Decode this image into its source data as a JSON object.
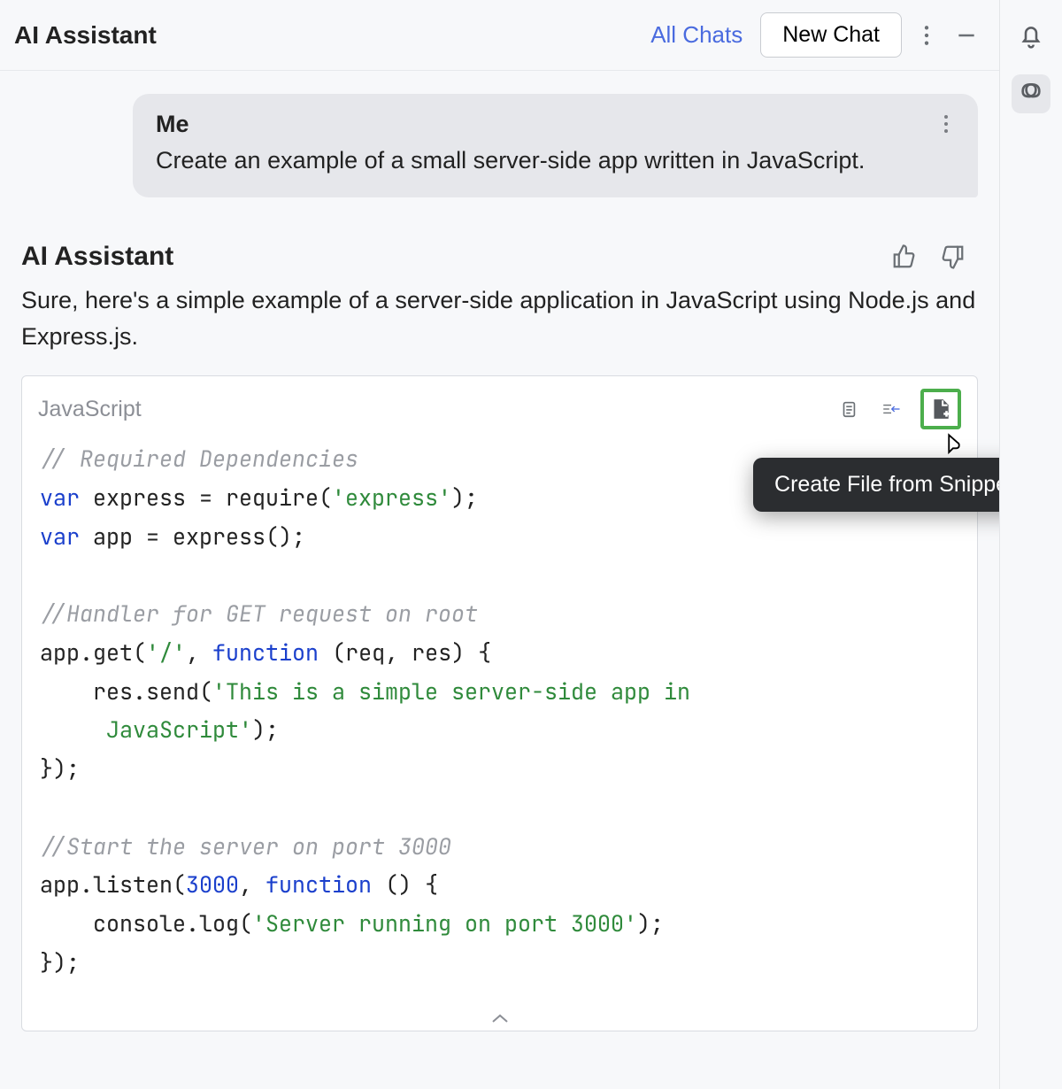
{
  "header": {
    "title": "AI Assistant",
    "all_chats": "All Chats",
    "new_chat": "New Chat"
  },
  "user_message": {
    "sender": "Me",
    "text": "Create an example of a small server-side app written in JavaScript."
  },
  "assistant_message": {
    "sender": "AI Assistant",
    "text": "Sure, here's a simple example of a server-side application in JavaScript using Node.js and Express.js."
  },
  "code_block": {
    "language": "JavaScript",
    "tooltip": "Create File from Snippet",
    "lines": {
      "c1": "// Required Dependencies",
      "kw_var1": "var",
      "l2a": " express = require(",
      "str1": "'express'",
      "l2b": ");",
      "kw_var2": "var",
      "l3": " app = express();",
      "c2": "//Handler for GET request on root",
      "l4a": "app.get(",
      "str2": "'/'",
      "l4b": ", ",
      "kw_fn1": "function",
      "l4c": " (req, res) {",
      "l5a": "    res.send(",
      "str3": "'This is a simple server-side app in \n     JavaScript'",
      "l5b": ");",
      "l6": "});",
      "c3": "//Start the server on port 3000",
      "l7a": "app.listen(",
      "num1": "3000",
      "l7b": ", ",
      "kw_fn2": "function",
      "l7c": " () {",
      "l8a": "    console.log(",
      "str4": "'Server running on port 3000'",
      "l8b": ");",
      "l9": "});"
    }
  }
}
